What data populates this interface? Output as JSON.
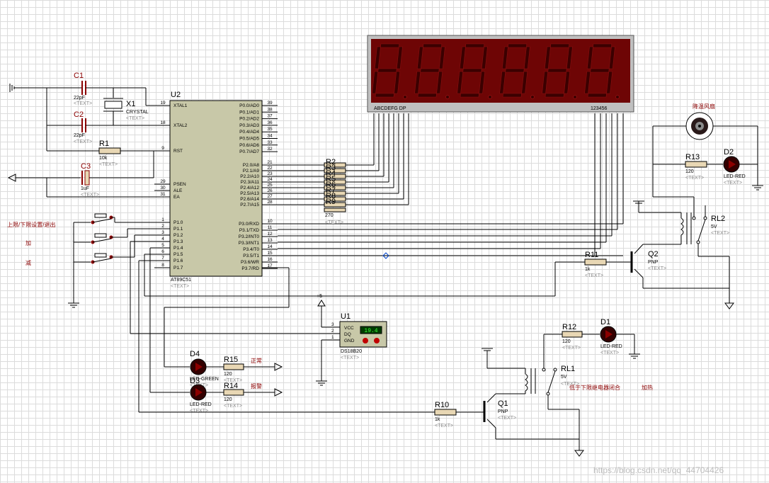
{
  "mcu": {
    "ref": "U2",
    "part": "AT89C51",
    "text": "<TEXT>",
    "left_pins": [
      {
        "num": "19",
        "name": "XTAL1"
      },
      {
        "num": "18",
        "name": "XTAL2"
      },
      {
        "num": "9",
        "name": "RST"
      },
      {
        "num": "29",
        "name": "PSEN"
      },
      {
        "num": "30",
        "name": "ALE"
      },
      {
        "num": "31",
        "name": "EA"
      },
      {
        "num": "1",
        "name": "P1.0"
      },
      {
        "num": "2",
        "name": "P1.1"
      },
      {
        "num": "3",
        "name": "P1.2"
      },
      {
        "num": "4",
        "name": "P1.3"
      },
      {
        "num": "5",
        "name": "P1.4"
      },
      {
        "num": "6",
        "name": "P1.5"
      },
      {
        "num": "7",
        "name": "P1.6"
      },
      {
        "num": "8",
        "name": "P1.7"
      }
    ],
    "right_pins": [
      {
        "num": "39",
        "name": "P0.0/AD0"
      },
      {
        "num": "38",
        "name": "P0.1/AD1"
      },
      {
        "num": "37",
        "name": "P0.2/AD2"
      },
      {
        "num": "36",
        "name": "P0.3/AD3"
      },
      {
        "num": "35",
        "name": "P0.4/AD4"
      },
      {
        "num": "34",
        "name": "P0.5/AD5"
      },
      {
        "num": "33",
        "name": "P0.6/AD6"
      },
      {
        "num": "32",
        "name": "P0.7/AD7"
      },
      {
        "num": "21",
        "name": "P2.0/A8"
      },
      {
        "num": "22",
        "name": "P2.1/A9"
      },
      {
        "num": "23",
        "name": "P2.2/A10"
      },
      {
        "num": "24",
        "name": "P2.3/A11"
      },
      {
        "num": "25",
        "name": "P2.4/A12"
      },
      {
        "num": "26",
        "name": "P2.5/A13"
      },
      {
        "num": "27",
        "name": "P2.6/A14"
      },
      {
        "num": "28",
        "name": "P2.7/A15"
      },
      {
        "num": "10",
        "name": "P3.0/RXD"
      },
      {
        "num": "11",
        "name": "P3.1/TXD"
      },
      {
        "num": "12",
        "name": "P3.2/INT0"
      },
      {
        "num": "13",
        "name": "P3.3/INT1"
      },
      {
        "num": "14",
        "name": "P3.4/T0"
      },
      {
        "num": "15",
        "name": "P3.5/T1"
      },
      {
        "num": "16",
        "name": "P3.6/WR"
      },
      {
        "num": "17",
        "name": "P3.7/RD"
      }
    ]
  },
  "caps": {
    "c1": {
      "ref": "C1",
      "value": "22pF",
      "text": "<TEXT>"
    },
    "c2": {
      "ref": "C2",
      "value": "22pF",
      "text": "<TEXT>"
    },
    "c3": {
      "ref": "C3",
      "value": "1uF",
      "text": "<TEXT>"
    }
  },
  "crystal": {
    "ref": "X1",
    "value": "CRYSTAL",
    "text": "<TEXT>"
  },
  "r1": {
    "ref": "R1",
    "value": "10k",
    "text": "<TEXT>"
  },
  "rnet": {
    "labels": [
      "R2",
      "R3",
      "R4",
      "R5",
      "R6",
      "R7",
      "R8",
      "R9"
    ],
    "value": "270",
    "text": "<TEXT>"
  },
  "display": {
    "segments": "ABCDEFG  DP",
    "digits": "123456",
    "digit_count": 6
  },
  "buttons": {
    "label1": "上限/下限设置/退出",
    "label2": "加",
    "label3": "减"
  },
  "sensor": {
    "ref": "U1",
    "part": "DS18B20",
    "reading": "19.4",
    "text": "<TEXT>",
    "pins": [
      {
        "num": "3",
        "name": "VCC"
      },
      {
        "num": "2",
        "name": "DQ"
      },
      {
        "num": "1",
        "name": "GND"
      }
    ],
    "net_label": "+5"
  },
  "d4": {
    "ref": "D4",
    "part": "LED-GREEN",
    "text": "<TEXT>"
  },
  "d3": {
    "ref": "D3",
    "part": "LED-RED",
    "text": "<TEXT>"
  },
  "r15": {
    "ref": "R15",
    "value": "120",
    "text": "<TEXT>",
    "note": "正常"
  },
  "r14": {
    "ref": "R14",
    "value": "120",
    "text": "<TEXT>",
    "note": "报警"
  },
  "fan": {
    "label": "降温风扇"
  },
  "r13": {
    "ref": "R13",
    "value": "120",
    "text": "<TEXT>"
  },
  "d2": {
    "ref": "D2",
    "part": "LED-RED",
    "text": "<TEXT>"
  },
  "rl2": {
    "ref": "RL2",
    "value": "5V",
    "text": "<TEXT>"
  },
  "q2": {
    "ref": "Q2",
    "type": "PNP",
    "text": "<TEXT>"
  },
  "r11": {
    "ref": "R11",
    "value": "1k",
    "text": "<TEXT>"
  },
  "r12": {
    "ref": "R12",
    "value": "120",
    "text": "<TEXT>"
  },
  "d1": {
    "ref": "D1",
    "part": "LED-RED",
    "text": "<TEXT>"
  },
  "rl1": {
    "ref": "RL1",
    "value": "5V",
    "text": "<TEXT>",
    "note1": "低于下限继电器闭合",
    "note2": "加热"
  },
  "q1": {
    "ref": "Q1",
    "type": "PNP",
    "text": "<TEXT>"
  },
  "r10": {
    "ref": "R10",
    "value": "1k",
    "text": "<TEXT>"
  },
  "watermark": "https://blog.csdn.net/qq_44704426"
}
